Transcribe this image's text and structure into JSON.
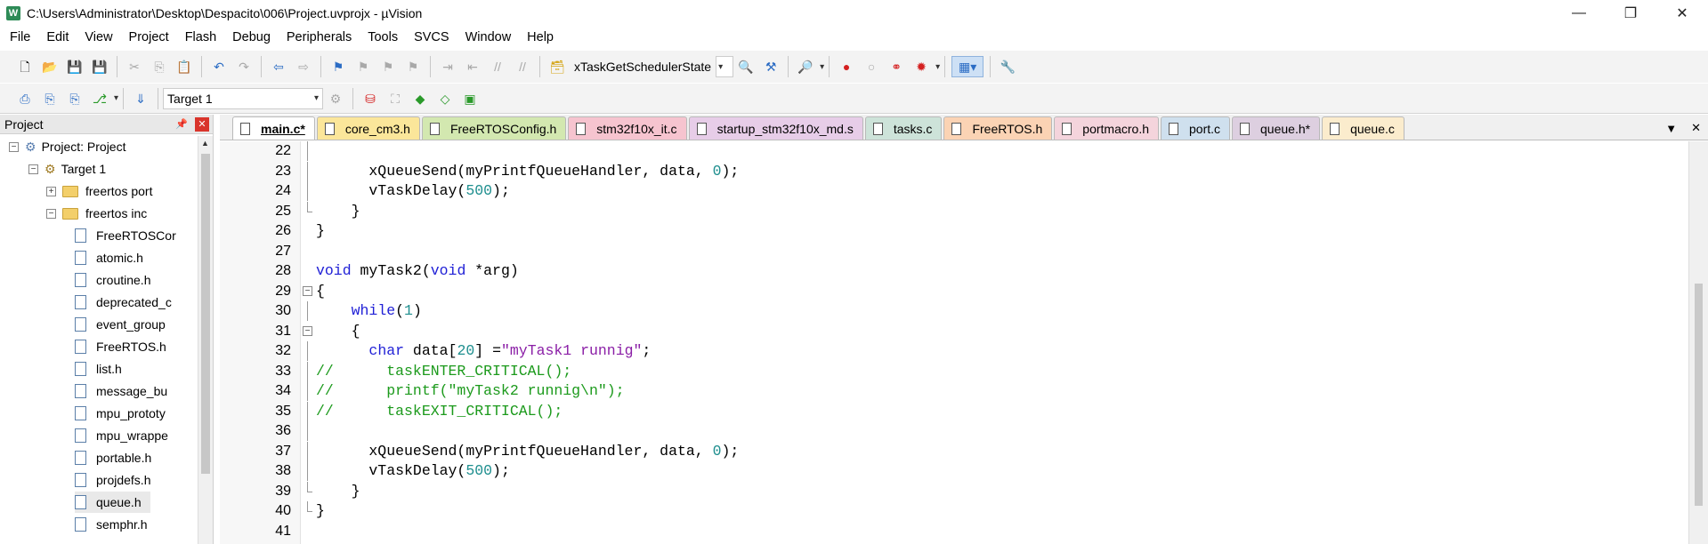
{
  "window": {
    "title": "C:\\Users\\Administrator\\Desktop\\Despacito\\006\\Project.uvprojx - µVision",
    "app_icon": "W",
    "controls": [
      "—",
      "❐",
      "✕"
    ]
  },
  "menu": [
    "File",
    "Edit",
    "View",
    "Project",
    "Flash",
    "Debug",
    "Peripherals",
    "Tools",
    "SVCS",
    "Window",
    "Help"
  ],
  "toolbar1": {
    "function_combo": "xTaskGetSchedulerState"
  },
  "toolbar2": {
    "target_combo": "Target 1"
  },
  "project_pane": {
    "title": "Project",
    "tree": [
      {
        "label": "Project: Project",
        "level": 0,
        "kind": "project",
        "expander": "−"
      },
      {
        "label": "Target 1",
        "level": 1,
        "kind": "target",
        "expander": "−"
      },
      {
        "label": "freertos port",
        "level": 2,
        "kind": "folder",
        "expander": "+"
      },
      {
        "label": "freertos inc",
        "level": 2,
        "kind": "folder",
        "expander": "−"
      },
      {
        "label": "FreeRTOSCor",
        "level": 3,
        "kind": "file"
      },
      {
        "label": "atomic.h",
        "level": 3,
        "kind": "file"
      },
      {
        "label": "croutine.h",
        "level": 3,
        "kind": "file"
      },
      {
        "label": "deprecated_c",
        "level": 3,
        "kind": "file"
      },
      {
        "label": "event_group",
        "level": 3,
        "kind": "file"
      },
      {
        "label": "FreeRTOS.h",
        "level": 3,
        "kind": "file"
      },
      {
        "label": "list.h",
        "level": 3,
        "kind": "file"
      },
      {
        "label": "message_bu",
        "level": 3,
        "kind": "file"
      },
      {
        "label": "mpu_prototy",
        "level": 3,
        "kind": "file"
      },
      {
        "label": "mpu_wrappe",
        "level": 3,
        "kind": "file"
      },
      {
        "label": "portable.h",
        "level": 3,
        "kind": "file"
      },
      {
        "label": "projdefs.h",
        "level": 3,
        "kind": "file"
      },
      {
        "label": "queue.h",
        "level": 3,
        "kind": "file",
        "selected": true
      },
      {
        "label": "semphr.h",
        "level": 3,
        "kind": "file"
      }
    ]
  },
  "editor": {
    "tabs": [
      {
        "label": "main.c*",
        "color": "#ffffff",
        "active": true
      },
      {
        "label": "core_cm3.h",
        "color": "#fbe69a"
      },
      {
        "label": "FreeRTOSConfig.h",
        "color": "#d3e8b0"
      },
      {
        "label": "stm32f10x_it.c",
        "color": "#f6c4cf"
      },
      {
        "label": "startup_stm32f10x_md.s",
        "color": "#e7cde8"
      },
      {
        "label": "tasks.c",
        "color": "#cde3d9"
      },
      {
        "label": "FreeRTOS.h",
        "color": "#fbd3b4"
      },
      {
        "label": "portmacro.h",
        "color": "#f4d4dc"
      },
      {
        "label": "port.c",
        "color": "#cfe0ee"
      },
      {
        "label": "queue.h*",
        "color": "#ddcfe0"
      },
      {
        "label": "queue.c",
        "color": "#fbeccd"
      }
    ],
    "lines": [
      {
        "n": "22",
        "fold": "line",
        "parts": []
      },
      {
        "n": "23",
        "fold": "line",
        "parts": [
          {
            "t": "      xQueueSend(myPrintfQueueHandler, data, ",
            "c": ""
          },
          {
            "t": "0",
            "c": "num"
          },
          {
            "t": ");",
            "c": ""
          }
        ]
      },
      {
        "n": "24",
        "fold": "line",
        "parts": [
          {
            "t": "      vTaskDelay(",
            "c": ""
          },
          {
            "t": "500",
            "c": "num"
          },
          {
            "t": ");",
            "c": ""
          }
        ]
      },
      {
        "n": "25",
        "fold": "end",
        "parts": [
          {
            "t": "    }",
            "c": ""
          }
        ]
      },
      {
        "n": "26",
        "fold": "",
        "parts": [
          {
            "t": "}",
            "c": ""
          }
        ]
      },
      {
        "n": "27",
        "fold": "",
        "parts": []
      },
      {
        "n": "28",
        "fold": "",
        "parts": [
          {
            "t": "void",
            "c": "kw"
          },
          {
            "t": " myTask2(",
            "c": ""
          },
          {
            "t": "void",
            "c": "kw"
          },
          {
            "t": " *arg)",
            "c": ""
          }
        ]
      },
      {
        "n": "29",
        "fold": "box",
        "parts": [
          {
            "t": "{",
            "c": ""
          }
        ]
      },
      {
        "n": "30",
        "fold": "line",
        "parts": [
          {
            "t": "    ",
            "c": ""
          },
          {
            "t": "while",
            "c": "kw"
          },
          {
            "t": "(",
            "c": ""
          },
          {
            "t": "1",
            "c": "num"
          },
          {
            "t": ")",
            "c": ""
          }
        ]
      },
      {
        "n": "31",
        "fold": "box",
        "parts": [
          {
            "t": "    {",
            "c": ""
          }
        ]
      },
      {
        "n": "32",
        "fold": "line",
        "parts": [
          {
            "t": "      ",
            "c": ""
          },
          {
            "t": "char",
            "c": "kw"
          },
          {
            "t": " data[",
            "c": ""
          },
          {
            "t": "20",
            "c": "num"
          },
          {
            "t": "] =",
            "c": ""
          },
          {
            "t": "\"myTask1 runnig\"",
            "c": "str"
          },
          {
            "t": ";",
            "c": ""
          }
        ]
      },
      {
        "n": "33",
        "fold": "line",
        "parts": [
          {
            "t": "//      taskENTER_CRITICAL();",
            "c": "cmt"
          }
        ]
      },
      {
        "n": "34",
        "fold": "line",
        "parts": [
          {
            "t": "//      printf(\"myTask2 runnig\\n\");",
            "c": "cmt"
          }
        ]
      },
      {
        "n": "35",
        "fold": "line",
        "parts": [
          {
            "t": "//      taskEXIT_CRITICAL();",
            "c": "cmt"
          }
        ]
      },
      {
        "n": "36",
        "fold": "line",
        "parts": []
      },
      {
        "n": "37",
        "fold": "line",
        "parts": [
          {
            "t": "      xQueueSend(myPrintfQueueHandler, data, ",
            "c": ""
          },
          {
            "t": "0",
            "c": "num"
          },
          {
            "t": ");",
            "c": ""
          }
        ]
      },
      {
        "n": "38",
        "fold": "line",
        "parts": [
          {
            "t": "      vTaskDelay(",
            "c": ""
          },
          {
            "t": "500",
            "c": "num"
          },
          {
            "t": ");",
            "c": ""
          }
        ]
      },
      {
        "n": "39",
        "fold": "end",
        "parts": [
          {
            "t": "    }",
            "c": ""
          }
        ]
      },
      {
        "n": "40",
        "fold": "end",
        "parts": [
          {
            "t": "}",
            "c": ""
          }
        ]
      },
      {
        "n": "41",
        "fold": "",
        "parts": []
      }
    ]
  }
}
